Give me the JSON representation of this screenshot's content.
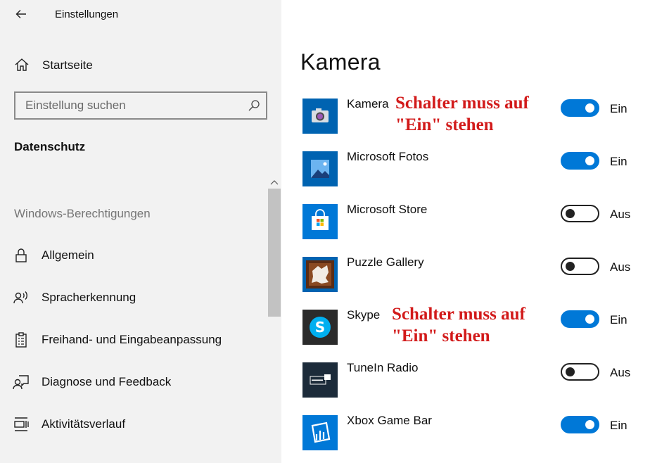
{
  "window": {
    "title": "Einstellungen"
  },
  "sidebar": {
    "home_label": "Startseite",
    "search": {
      "placeholder": "Einstellung suchen",
      "value": ""
    },
    "section": "Datenschutz",
    "group_heading": "Windows-Berechtigungen",
    "items": [
      {
        "label": "Allgemein",
        "icon": "lock-icon"
      },
      {
        "label": "Spracherkennung",
        "icon": "speech-icon"
      },
      {
        "label": "Freihand- und Eingabeanpassung",
        "icon": "clipboard-icon"
      },
      {
        "label": "Diagnose und Feedback",
        "icon": "feedback-icon"
      },
      {
        "label": "Aktivitätsverlauf",
        "icon": "timeline-icon"
      }
    ]
  },
  "main": {
    "title": "Kamera",
    "apps": [
      {
        "name": "Kamera",
        "state": "Ein",
        "on": true,
        "icon": "camera-app-icon"
      },
      {
        "name": "Microsoft Fotos",
        "state": "Ein",
        "on": true,
        "icon": "photos-app-icon"
      },
      {
        "name": "Microsoft Store",
        "state": "Aus",
        "on": false,
        "icon": "store-app-icon"
      },
      {
        "name": "Puzzle Gallery",
        "state": "Aus",
        "on": false,
        "icon": "puzzle-app-icon"
      },
      {
        "name": "Skype",
        "state": "Ein",
        "on": true,
        "icon": "skype-app-icon"
      },
      {
        "name": "TuneIn Radio",
        "state": "Aus",
        "on": false,
        "icon": "tunein-app-icon"
      },
      {
        "name": "Xbox Game Bar",
        "state": "Ein",
        "on": true,
        "icon": "xbox-app-icon"
      }
    ]
  },
  "annotations": [
    {
      "line1": "Schalter muss auf",
      "line2": "\"Ein\" stehen"
    },
    {
      "line1": "Schalter muss auf",
      "line2": "\"Ein\" stehen"
    }
  ],
  "colors": {
    "accent": "#0078d7",
    "annotation": "#d21a1a",
    "sidebar_bg": "#f2f2f2"
  }
}
